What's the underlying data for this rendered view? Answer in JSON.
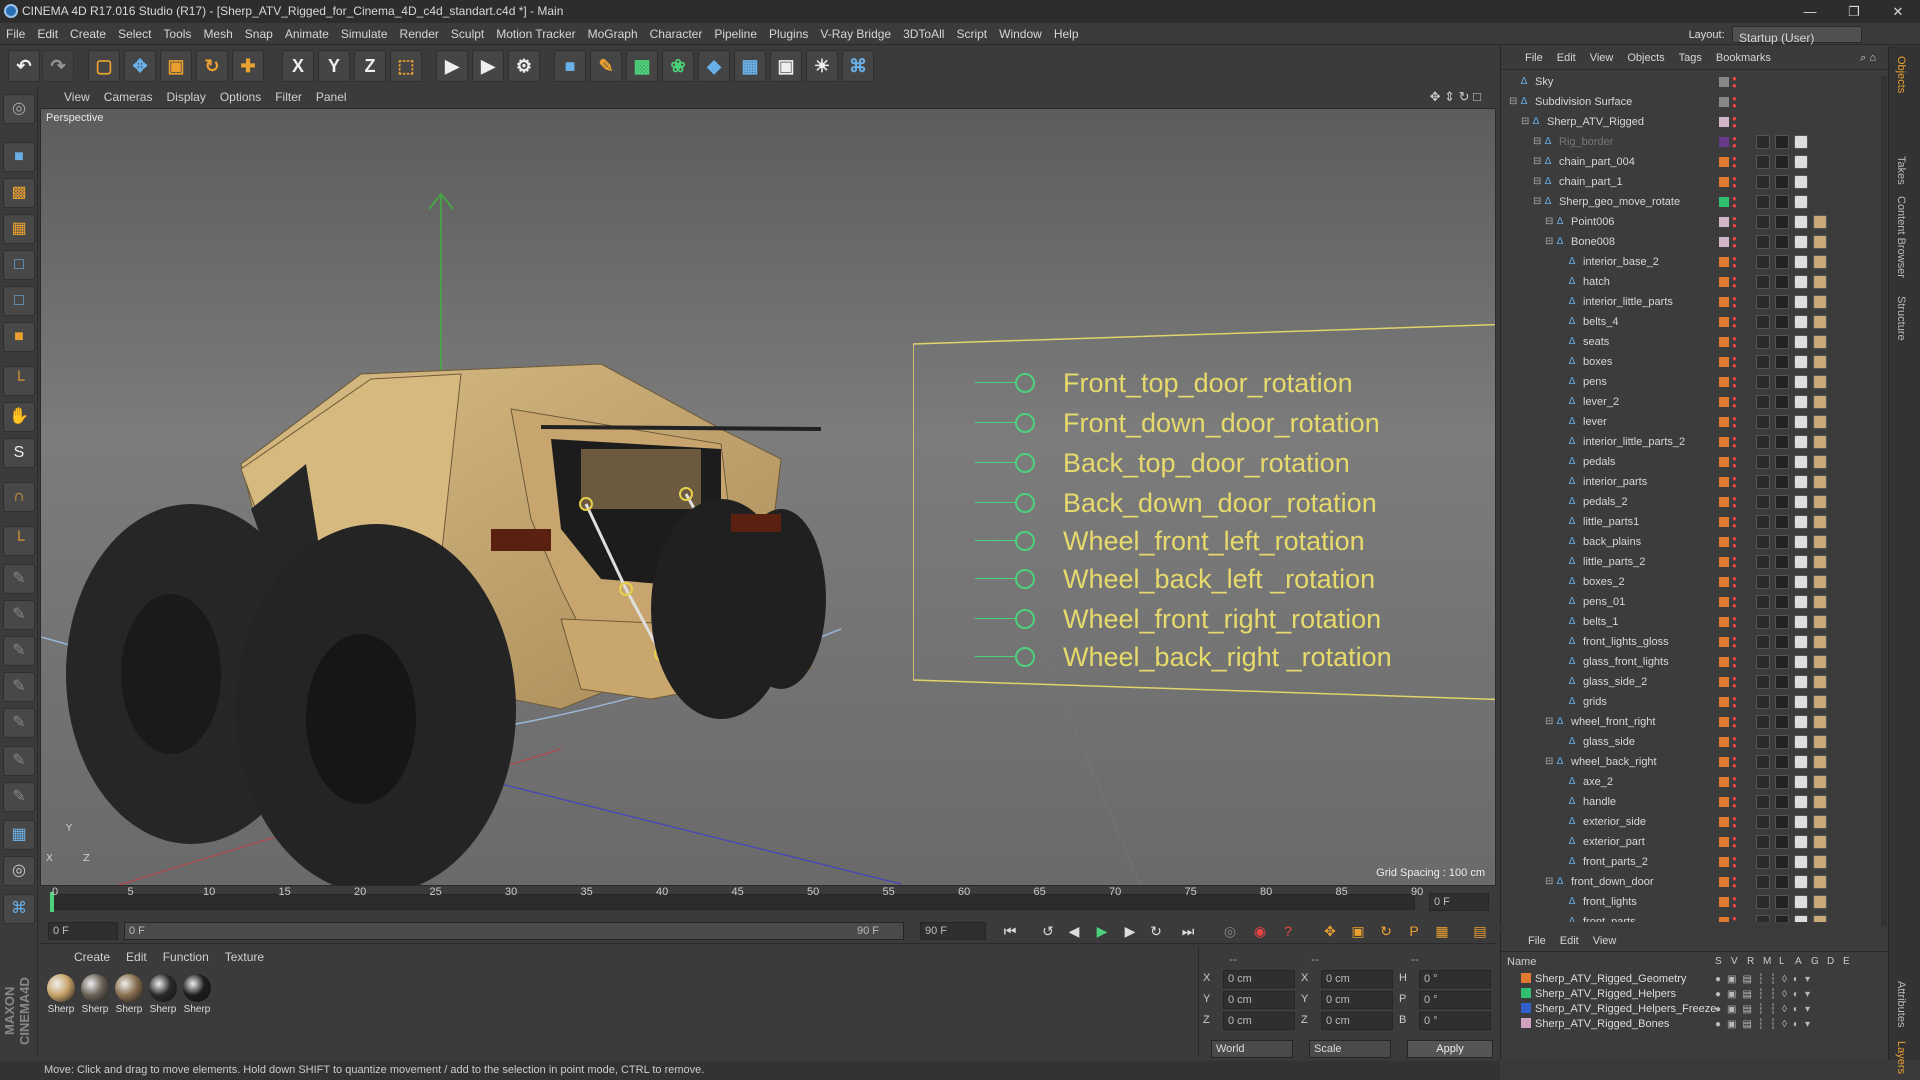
{
  "window": {
    "title": "CINEMA 4D R17.016 Studio (R17) - [Sherp_ATV_Rigged_for_Cinema_4D_c4d_standart.c4d *] - Main",
    "controls": [
      "—",
      "❐",
      "✕"
    ]
  },
  "menubar": {
    "items": [
      "File",
      "Edit",
      "Create",
      "Select",
      "Tools",
      "Mesh",
      "Snap",
      "Animate",
      "Simulate",
      "Render",
      "Sculpt",
      "Motion Tracker",
      "MoGraph",
      "Character",
      "Pipeline",
      "Plugins",
      "V-Ray Bridge",
      "3DToAll",
      "Script",
      "Window",
      "Help"
    ],
    "layout_label": "Layout:",
    "layout_value": "Startup (User)"
  },
  "viewport": {
    "menu": [
      "View",
      "Cameras",
      "Display",
      "Options",
      "Filter",
      "Panel"
    ],
    "camera_label": "Perspective",
    "grid_spacing": "Grid Spacing : 100 cm",
    "axis_labels": [
      "Y",
      "X",
      "Z"
    ],
    "hud_controls": [
      "Front_top_door_rotation",
      "Front_down_door_rotation",
      "Back_top_door_rotation",
      "Back_down_door_rotation",
      "Wheel_front_left_rotation",
      "Wheel_back_left _rotation",
      "Wheel_front_right_rotation",
      "Wheel_back_right _rotation"
    ]
  },
  "timeline": {
    "ticks": [
      "0",
      "5",
      "10",
      "15",
      "20",
      "25",
      "30",
      "35",
      "40",
      "45",
      "50",
      "55",
      "60",
      "65",
      "70",
      "75",
      "80",
      "85",
      "90"
    ],
    "current_frame": "0 F",
    "end_frame_display": "0 F",
    "start_field": "0 F",
    "range_start": "0 F",
    "range_end": "90 F",
    "max_field": "90 F"
  },
  "materials": {
    "menu": [
      "Create",
      "Edit",
      "Function",
      "Texture"
    ],
    "items": [
      {
        "label": "Sherp",
        "color": "#c9a46a"
      },
      {
        "label": "Sherp",
        "color": "#6b6257"
      },
      {
        "label": "Sherp",
        "color": "#8a7050"
      },
      {
        "label": "Sherp",
        "color": "#2a2a2a"
      },
      {
        "label": "Sherp",
        "color": "#1e1e1e"
      }
    ]
  },
  "coordinates": {
    "headers": [
      "--",
      "--",
      "--"
    ],
    "rows": [
      {
        "a": "X",
        "av": "0 cm",
        "b": "X",
        "bv": "0 cm",
        "c": "H",
        "cv": "0 °"
      },
      {
        "a": "Y",
        "av": "0 cm",
        "b": "Y",
        "bv": "0 cm",
        "c": "P",
        "cv": "0 °"
      },
      {
        "a": "Z",
        "av": "0 cm",
        "b": "Z",
        "bv": "0 cm",
        "c": "B",
        "cv": "0 °"
      }
    ],
    "mode1": "World",
    "mode2": "Scale",
    "apply": "Apply"
  },
  "status": "Move: Click and drag to move elements. Hold down SHIFT to quantize movement / add to the selection in point mode, CTRL to remove.",
  "object_manager": {
    "menu": [
      "File",
      "Edit",
      "View",
      "Objects",
      "Tags",
      "Bookmarks"
    ],
    "objects": [
      {
        "name": "Sky",
        "indent": 0,
        "expand": false,
        "tag": "#888888"
      },
      {
        "name": "Subdivision Surface",
        "indent": 0,
        "expand": true,
        "tag": "#888888"
      },
      {
        "name": "Sherp_ATV_Rigged",
        "indent": 1,
        "expand": true,
        "tag": "#d0b8c8"
      },
      {
        "name": "Rig_border",
        "indent": 2,
        "expand": true,
        "tag": "#6a3a8a"
      },
      {
        "name": "chain_part_004",
        "indent": 2,
        "expand": true,
        "tag": "#e07a30"
      },
      {
        "name": "chain_part_1",
        "indent": 2,
        "expand": true,
        "tag": "#e07a30"
      },
      {
        "name": "Sherp_geo_move_rotate",
        "indent": 2,
        "expand": true,
        "tag": "#30c070"
      },
      {
        "name": "Point006",
        "indent": 3,
        "expand": true,
        "tag": "#d0b8c8"
      },
      {
        "name": "Bone008",
        "indent": 3,
        "expand": true,
        "tag": "#d0b8c8"
      },
      {
        "name": "interior_base_2",
        "indent": 4,
        "expand": false,
        "tag": "#e07a30"
      },
      {
        "name": "hatch",
        "indent": 4,
        "expand": false,
        "tag": "#e07a30"
      },
      {
        "name": "interior_little_parts",
        "indent": 4,
        "expand": false,
        "tag": "#e07a30"
      },
      {
        "name": "belts_4",
        "indent": 4,
        "expand": false,
        "tag": "#e07a30"
      },
      {
        "name": "seats",
        "indent": 4,
        "expand": false,
        "tag": "#e07a30"
      },
      {
        "name": "boxes",
        "indent": 4,
        "expand": false,
        "tag": "#e07a30"
      },
      {
        "name": "pens",
        "indent": 4,
        "expand": false,
        "tag": "#e07a30"
      },
      {
        "name": "lever_2",
        "indent": 4,
        "expand": false,
        "tag": "#e07a30"
      },
      {
        "name": "lever",
        "indent": 4,
        "expand": false,
        "tag": "#e07a30"
      },
      {
        "name": "interior_little_parts_2",
        "indent": 4,
        "expand": false,
        "tag": "#e07a30"
      },
      {
        "name": "pedals",
        "indent": 4,
        "expand": false,
        "tag": "#e07a30"
      },
      {
        "name": "interior_parts",
        "indent": 4,
        "expand": false,
        "tag": "#e07a30"
      },
      {
        "name": "pedals_2",
        "indent": 4,
        "expand": false,
        "tag": "#e07a30"
      },
      {
        "name": "little_parts1",
        "indent": 4,
        "expand": false,
        "tag": "#e07a30"
      },
      {
        "name": "back_plains",
        "indent": 4,
        "expand": false,
        "tag": "#e07a30"
      },
      {
        "name": "little_parts_2",
        "indent": 4,
        "expand": false,
        "tag": "#e07a30"
      },
      {
        "name": "boxes_2",
        "indent": 4,
        "expand": false,
        "tag": "#e07a30"
      },
      {
        "name": "pens_01",
        "indent": 4,
        "expand": false,
        "tag": "#e07a30"
      },
      {
        "name": "belts_1",
        "indent": 4,
        "expand": false,
        "tag": "#e07a30"
      },
      {
        "name": "front_lights_gloss",
        "indent": 4,
        "expand": false,
        "tag": "#e07a30"
      },
      {
        "name": "glass_front_lights",
        "indent": 4,
        "expand": false,
        "tag": "#e07a30"
      },
      {
        "name": "glass_side_2",
        "indent": 4,
        "expand": false,
        "tag": "#e07a30"
      },
      {
        "name": "grids",
        "indent": 4,
        "expand": false,
        "tag": "#e07a30"
      },
      {
        "name": "wheel_front_right",
        "indent": 3,
        "expand": true,
        "tag": "#e07a30"
      },
      {
        "name": "glass_side",
        "indent": 4,
        "expand": false,
        "tag": "#e07a30"
      },
      {
        "name": "wheel_back_right",
        "indent": 3,
        "expand": true,
        "tag": "#e07a30"
      },
      {
        "name": "axe_2",
        "indent": 4,
        "expand": false,
        "tag": "#e07a30"
      },
      {
        "name": "handle",
        "indent": 4,
        "expand": false,
        "tag": "#e07a30"
      },
      {
        "name": "exterior_side",
        "indent": 4,
        "expand": false,
        "tag": "#e07a30"
      },
      {
        "name": "exterior_part",
        "indent": 4,
        "expand": false,
        "tag": "#e07a30"
      },
      {
        "name": "front_parts_2",
        "indent": 4,
        "expand": false,
        "tag": "#e07a30"
      },
      {
        "name": "front_down_door",
        "indent": 3,
        "expand": true,
        "tag": "#e07a30"
      },
      {
        "name": "front_lights",
        "indent": 4,
        "expand": false,
        "tag": "#e07a30"
      },
      {
        "name": "front_parts",
        "indent": 4,
        "expand": false,
        "tag": "#e07a30"
      }
    ]
  },
  "layers": {
    "menu": [
      "File",
      "Edit",
      "View"
    ],
    "name_header": "Name",
    "col_headers": [
      "S",
      "V",
      "R",
      "M",
      "L",
      "A",
      "G",
      "D",
      "E"
    ],
    "items": [
      {
        "name": "Sherp_ATV_Rigged_Geometry",
        "color": "#e07a30"
      },
      {
        "name": "Sherp_ATV_Rigged_Helpers",
        "color": "#30c070"
      },
      {
        "name": "Sherp_ATV_Rigged_Helpers_Freeze",
        "color": "#3060d0"
      },
      {
        "name": "Sherp_ATV_Rigged_Bones",
        "color": "#d0a0c0"
      }
    ]
  },
  "side_tabs": [
    "Objects",
    "Takes",
    "Content Browser",
    "Structure",
    "Attributes",
    "Layers"
  ]
}
